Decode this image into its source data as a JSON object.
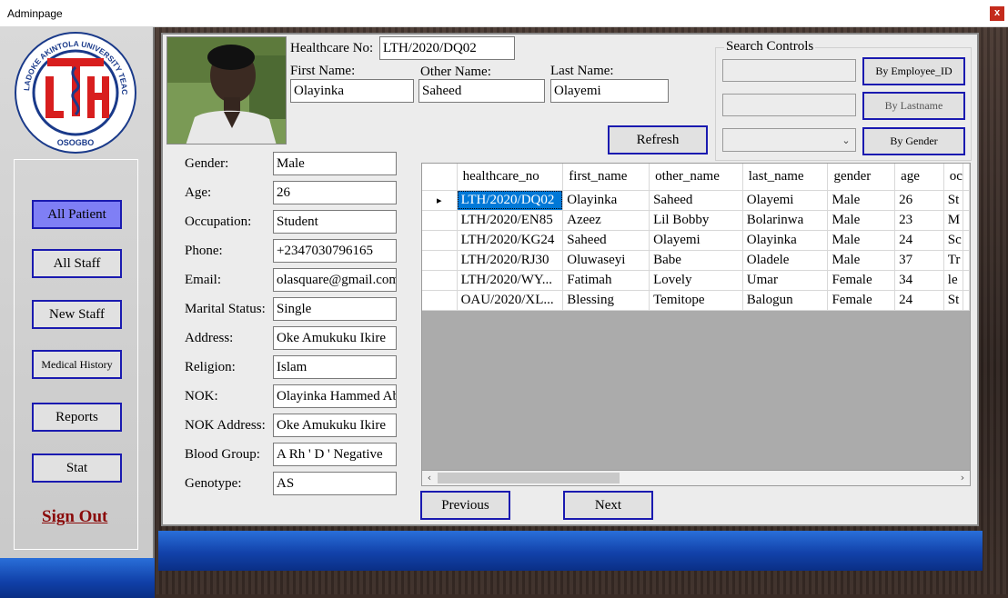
{
  "window": {
    "title": "Adminpage",
    "close_glyph": "x"
  },
  "logo": {
    "ring_text": "LADOKE AKINTOLA UNIVERSITY TEACHING HOSPITAL",
    "bottom_text": "OSOGBO",
    "monogram": "LTH"
  },
  "nav": {
    "items": [
      {
        "label": "All Patient"
      },
      {
        "label": "All Staff"
      },
      {
        "label": "New Staff"
      },
      {
        "label": "Medical History"
      },
      {
        "label": "Reports"
      },
      {
        "label": "Stat"
      }
    ],
    "signout": "Sign Out"
  },
  "header": {
    "healthcare_no_label": "Healthcare No:",
    "healthcare_no": "LTH/2020/DQ02",
    "first_name_label": "First Name:",
    "first_name": "Olayinka",
    "other_name_label": "Other Name:",
    "other_name": "Saheed",
    "last_name_label": "Last Name:",
    "last_name": "Olayemi",
    "refresh_label": "Refresh"
  },
  "search": {
    "legend": "Search Controls",
    "employee_id_value": "",
    "lastname_value": "",
    "gender_value": "",
    "by_employee_id": "By Employee_ID",
    "by_lastname": "By Lastname",
    "by_gender": "By Gender"
  },
  "details": [
    {
      "label": "Gender:",
      "value": "Male"
    },
    {
      "label": "Age:",
      "value": "26"
    },
    {
      "label": "Occupation:",
      "value": "Student"
    },
    {
      "label": "Phone:",
      "value": "+2347030796165"
    },
    {
      "label": "Email:",
      "value": "olasquare@gmail.com"
    },
    {
      "label": "Marital Status:",
      "value": "Single"
    },
    {
      "label": "Address:",
      "value": "Oke Amukuku Ikire"
    },
    {
      "label": "Religion:",
      "value": "Islam"
    },
    {
      "label": "NOK:",
      "value": "Olayinka Hammed Ab"
    },
    {
      "label": "NOK Address:",
      "value": "Oke Amukuku Ikire"
    },
    {
      "label": "Blood Group:",
      "value": "A Rh ' D ' Negative"
    },
    {
      "label": "Genotype:",
      "value": "AS"
    }
  ],
  "grid": {
    "columns": [
      "healthcare_no",
      "first_name",
      "other_name",
      "last_name",
      "gender",
      "age",
      "oc"
    ],
    "current_row_marker": "▸",
    "rows": [
      [
        "LTH/2020/DQ02",
        "Olayinka",
        "Saheed",
        "Olayemi",
        "Male",
        "26",
        "St"
      ],
      [
        "LTH/2020/EN85",
        "Azeez",
        "Lil Bobby",
        "Bolarinwa",
        "Male",
        "23",
        "M"
      ],
      [
        "LTH/2020/KG24",
        "Saheed",
        "Olayemi",
        "Olayinka",
        "Male",
        "24",
        "Sc"
      ],
      [
        "LTH/2020/RJ30",
        "Oluwaseyi",
        "Babe",
        "Oladele",
        "Male",
        "37",
        "Tr"
      ],
      [
        "LTH/2020/WY...",
        "Fatimah",
        "Lovely",
        "Umar",
        "Female",
        "34",
        "le"
      ],
      [
        "OAU/2020/XL...",
        "Blessing",
        "Temitope",
        "Balogun",
        "Female",
        "24",
        "St"
      ]
    ],
    "scroll_left": "‹",
    "scroll_right": "›"
  },
  "pager": {
    "previous": "Previous",
    "next": "Next"
  }
}
